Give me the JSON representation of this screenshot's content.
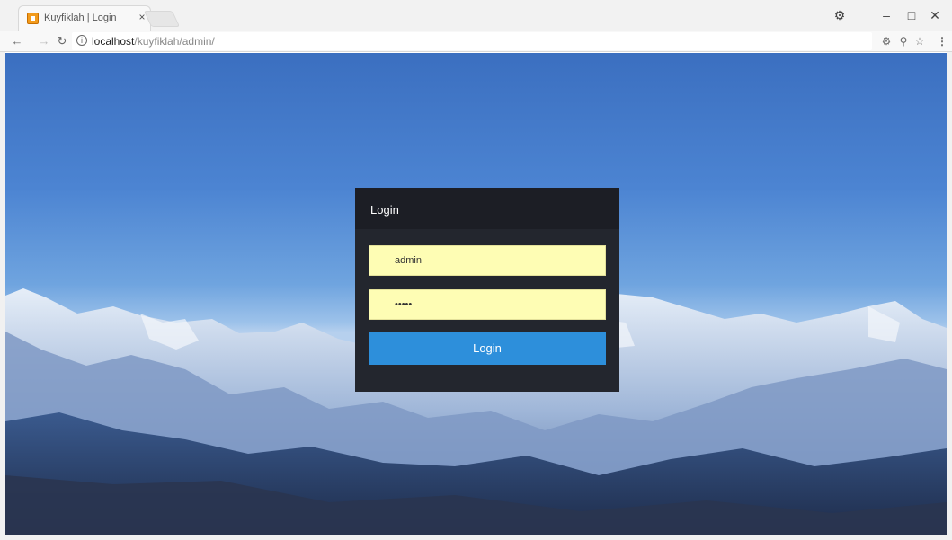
{
  "browser": {
    "tab": {
      "title": "Kuyfiklah | Login",
      "close_glyph": "×",
      "favicon": "app-logo-icon"
    },
    "window_controls": {
      "profile": "⚙",
      "minimize": "–",
      "maximize": "□",
      "close": "✕"
    },
    "address_bar": {
      "host": "localhost",
      "path": "/kuyfiklah/admin/"
    },
    "icons": [
      "back-icon",
      "forward-icon",
      "reload-icon",
      "info-icon",
      "key-icon",
      "zoom-icon",
      "star-icon",
      "menu-icon"
    ]
  },
  "login": {
    "title": "Login",
    "username_value": "admin",
    "password_value": "admin",
    "button_label": "Login"
  },
  "colors": {
    "panel": "#23262e",
    "panel_header": "#1c1e25",
    "field": "#fefdb4",
    "button": "#2d8fdb"
  }
}
